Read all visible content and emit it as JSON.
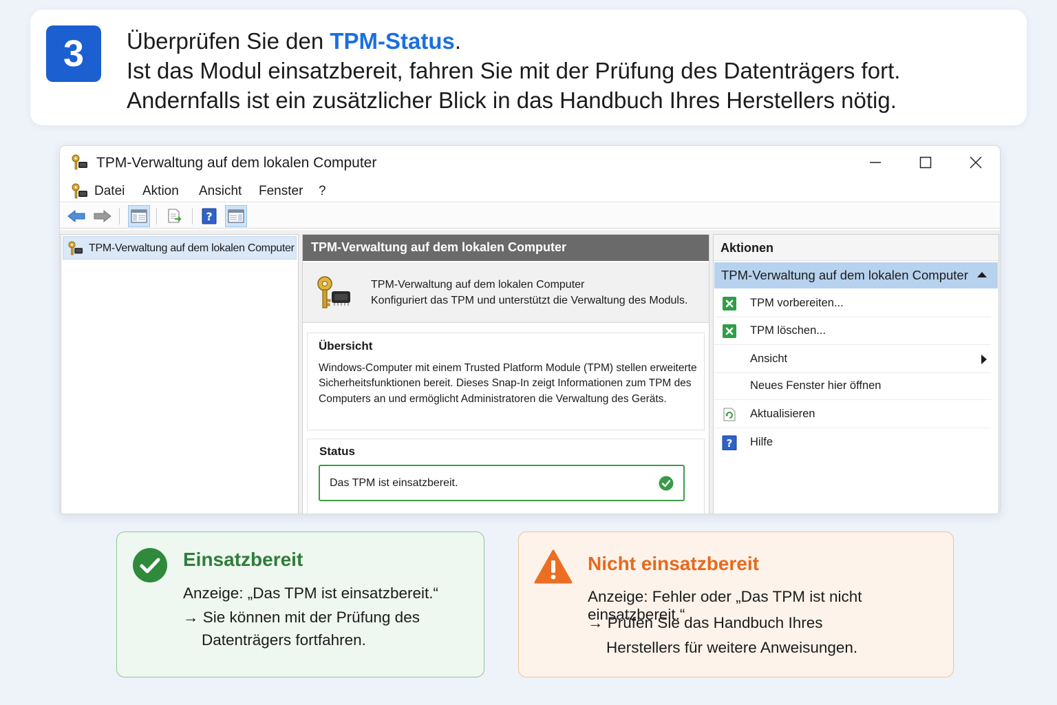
{
  "header": {
    "step_number": "3",
    "line1_prefix": "Überprüfen Sie den ",
    "line1_highlight": "TPM-Status",
    "line1_suffix": ".",
    "line2": "Ist das Modul einsatzbereit, fahren Sie mit der Prüfung des Datenträgers fort.",
    "line3": "Andernfalls ist ein zusätzlicher Blick in das Handbuch Ihres Herstellers nötig."
  },
  "window": {
    "title": "TPM-Verwaltung auf dem lokalen Computer",
    "menu": [
      "Datei",
      "Aktion",
      "Ansicht",
      "Fenster",
      "?"
    ],
    "toolbar_icons": [
      "back-arrow-icon",
      "forward-arrow-icon",
      "console-tree-icon",
      "export-list-icon",
      "help-icon",
      "show-action-pane-icon"
    ],
    "tree": {
      "item_label": "TPM-Verwaltung auf dem lokalen Computer"
    },
    "center": {
      "header": "TPM-Verwaltung auf dem lokalen Computer",
      "snapin_title": "TPM-Verwaltung auf dem lokalen Computer",
      "snapin_desc": "Konfiguriert das TPM und unterstützt die Verwaltung des Moduls.",
      "overview_heading": "Übersicht",
      "overview_text": "Windows-Computer mit einem Trusted Platform Module (TPM) stellen erweiterte Sicherheitsfunktionen bereit. Dieses Snap-In zeigt Informationen zum TPM des Computers an und ermöglicht Administratoren die Verwaltung des Geräts.",
      "status_heading": "Status",
      "status_value": "Das TPM ist einsatzbereit."
    },
    "actions": {
      "heading": "Aktionen",
      "group": "TPM-Verwaltung auf dem lokalen Computer",
      "items": [
        {
          "label": "TPM vorbereiten...",
          "icon": "tpm-action-icon"
        },
        {
          "label": "TPM löschen...",
          "icon": "tpm-action-icon"
        },
        {
          "label": "Ansicht",
          "icon": "",
          "submenu": true
        },
        {
          "label": "Neues Fenster hier öffnen",
          "icon": ""
        },
        {
          "label": "Aktualisieren",
          "icon": "refresh-icon"
        },
        {
          "label": "Hilfe",
          "icon": "help-icon"
        }
      ]
    }
  },
  "cards": {
    "ok": {
      "heading": "Einsatzbereit",
      "line1": "Anzeige: „Das TPM ist einsatzbereit.“",
      "line2": "Sie können mit der Prüfung des",
      "line3": "Datenträgers fortfahren."
    },
    "warn": {
      "heading": "Nicht einsatzbereit",
      "line1": "Anzeige: Fehler oder „Das TPM ist nicht einsatzbereit.“",
      "line2": "Prüfen Sie das Handbuch Ihres",
      "line3": "Herstellers für weitere Anweisungen."
    }
  },
  "colors": {
    "accent_blue": "#1b6fe0",
    "badge_blue": "#1b5fd1",
    "success_green": "#2e7d3a",
    "warning_orange": "#e56a1e"
  }
}
